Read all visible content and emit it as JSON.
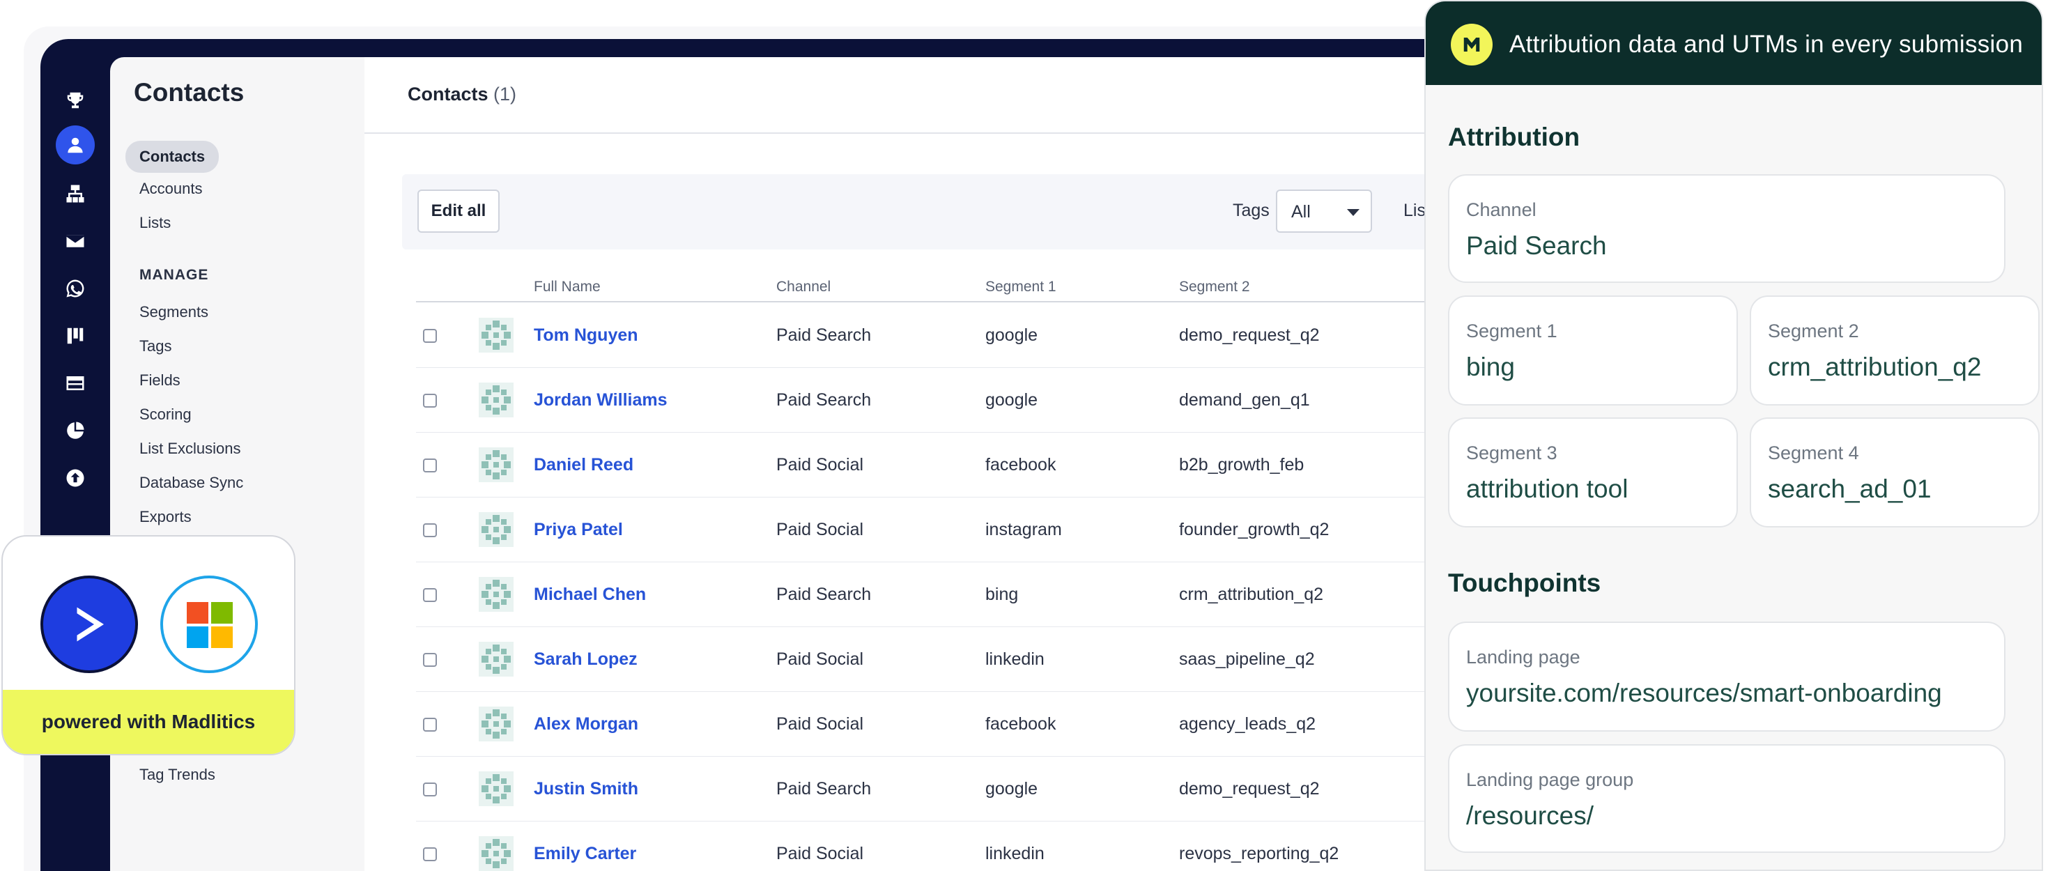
{
  "rail": {
    "icons": [
      "trophy-icon",
      "contacts-person-icon",
      "sitemap-icon",
      "mail-icon",
      "whatsapp-icon",
      "kanban-icon",
      "browser-window-icon",
      "pie-chart-icon",
      "upload-circle-icon"
    ]
  },
  "sidebar": {
    "title": "Contacts",
    "items": [
      "Contacts",
      "Accounts",
      "Lists"
    ],
    "manage_heading": "MANAGE",
    "manage_items": [
      "Segments",
      "Tags",
      "Fields",
      "Scoring",
      "List Exclusions",
      "Database Sync",
      "Exports"
    ],
    "bottom_item": "Tag Trends"
  },
  "main": {
    "title": "Contacts",
    "count": "(1)",
    "edit_all": "Edit all",
    "tags_label": "Tags",
    "tags_value": "All",
    "list_label": "List"
  },
  "table": {
    "headers": [
      "Full Name",
      "Channel",
      "Segment 1",
      "Segment 2"
    ],
    "rows": [
      {
        "name": "Tom Nguyen",
        "channel": "Paid Search",
        "segment1": "google",
        "segment2": "demo_request_q2"
      },
      {
        "name": "Jordan Williams",
        "channel": "Paid Search",
        "segment1": "google",
        "segment2": "demand_gen_q1"
      },
      {
        "name": "Daniel Reed",
        "channel": "Paid Social",
        "segment1": "facebook",
        "segment2": "b2b_growth_feb"
      },
      {
        "name": "Priya Patel",
        "channel": "Paid Social",
        "segment1": "instagram",
        "segment2": "founder_growth_q2"
      },
      {
        "name": "Michael Chen",
        "channel": "Paid Search",
        "segment1": "bing",
        "segment2": "crm_attribution_q2"
      },
      {
        "name": "Sarah Lopez",
        "channel": "Paid Social",
        "segment1": "linkedin",
        "segment2": "saas_pipeline_q2"
      },
      {
        "name": "Alex Morgan",
        "channel": "Paid Social",
        "segment1": "facebook",
        "segment2": "agency_leads_q2"
      },
      {
        "name": "Justin Smith",
        "channel": "Paid Search",
        "segment1": "google",
        "segment2": "demo_request_q2"
      },
      {
        "name": "Emily Carter",
        "channel": "Paid Social",
        "segment1": "linkedin",
        "segment2": "revops_reporting_q2"
      }
    ]
  },
  "badge": {
    "text": "powered with Madlitics",
    "logos": [
      "activecampaign-logo",
      "microsoft-logo"
    ]
  },
  "panel": {
    "header": "Attribution data and UTMs in every submission",
    "attribution_title": "Attribution",
    "channel_label": "Channel",
    "channel_value": "Paid Search",
    "segment1_label": "Segment 1",
    "segment1_value": "bing",
    "segment2_label": "Segment 2",
    "segment2_value": "crm_attribution_q2",
    "segment3_label": "Segment 3",
    "segment3_value": "attribution tool",
    "segment4_label": "Segment 4",
    "segment4_value": "search_ad_01",
    "touchpoints_title": "Touchpoints",
    "landing_page_label": "Landing page",
    "landing_page_value": "yoursite.com/resources/smart-onboarding",
    "landing_group_label": "Landing page group",
    "landing_group_value": "/resources/"
  },
  "colors": {
    "navy": "#0b1138",
    "accent_blue": "#2f54eb",
    "link_blue": "#2753d6",
    "panel_header": "#0c2d2a",
    "badge_yellow": "#eef85e"
  }
}
